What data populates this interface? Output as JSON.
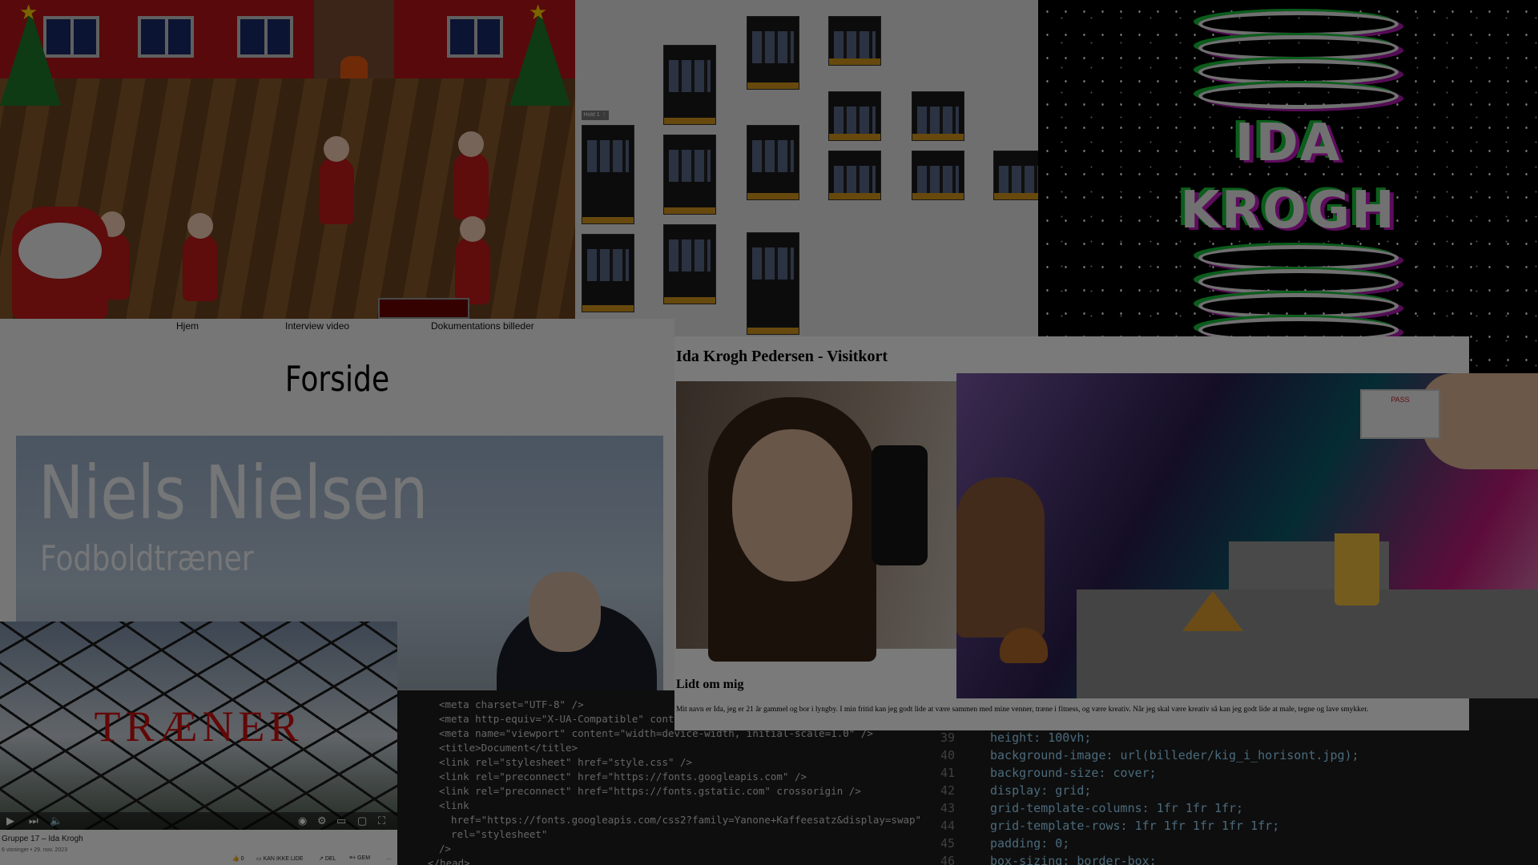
{
  "game": {
    "nav_home": "Hjem",
    "nav_interview": "Interview video",
    "nav_docs": "Dokumentations billeder"
  },
  "wireframes": {
    "label": "Hold 1 ⋮"
  },
  "glitch": {
    "line1": "IDA",
    "line2": "KROGH"
  },
  "forside": {
    "title": "Forside",
    "hero_name": "Niels Nielsen",
    "hero_role": "Fodboldtræner"
  },
  "video": {
    "overlay_title": "TRÆNER",
    "title": "Gruppe 17 – Ida Krogh",
    "meta": "6 visninger • 29. nov. 2023",
    "like_count": "0",
    "dislike_label": "KAN IKKE LIDE",
    "share_label": "DEL",
    "save_label": "GEM",
    "more_label": "…"
  },
  "code_left": {
    "lines": [
      "<meta charset=\"UTF-8\" />",
      "<meta http-equiv=\"X-UA-Compatible\" content=\"IE=edge\" />",
      "<meta name=\"viewport\" content=\"width=device-width, initial-scale=1.0\" />",
      "<title>Document</title>",
      "<link rel=\"stylesheet\" href=\"style.css\" />",
      "<link rel=\"preconnect\" href=\"https://fonts.googleapis.com\" />",
      "<link rel=\"preconnect\" href=\"https://fonts.gstatic.com\" crossorigin />",
      "<link",
      "  href=\"https://fonts.googleapis.com/css2?family=Yanone+Kaffeesatz&display=swap\"",
      "  rel=\"stylesheet\"",
      "/>",
      "</head>"
    ]
  },
  "code_right": {
    "line_numbers": [
      "39",
      "40",
      "41",
      "42",
      "43",
      "44",
      "45",
      "46"
    ],
    "lines": [
      "height: 100vh;",
      "background-image: url(billeder/kig_i_horisont.jpg);",
      "background-size: cover;",
      "display: grid;",
      "grid-template-columns: 1fr 1fr 1fr;",
      "grid-template-rows: 1fr 1fr 1fr 1fr 1fr;",
      "padding: 0;",
      "box-sizing: border-box;"
    ]
  },
  "visitkort": {
    "title": "Ida Krogh Pedersen - Visitkort",
    "subtitle": "Lidt om mig",
    "text": "Mit navn er Ida, jeg er 21 år gammel og bor i lyngby. I min fritid kan jeg godt lide at være sammen med mine venner, træne i fitness, og være kreativ. Når jeg skal være kreativ så kan jeg godt lide at male, tegne og lave smykker."
  },
  "collage": {
    "card_label": "PASS"
  }
}
